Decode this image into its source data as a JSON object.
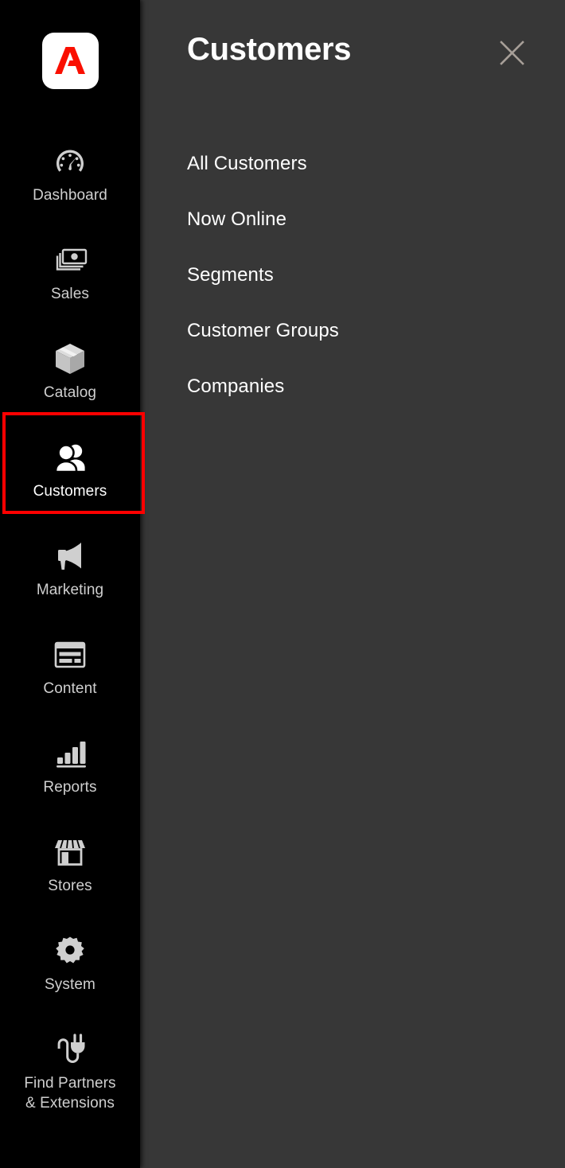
{
  "brand": {
    "logo_icon": "adobe-logo-icon",
    "logo_color": "#ff0000",
    "logo_tile_color": "#ffffff"
  },
  "colors": {
    "sidebar_background": "#000000",
    "panel_background": "#373737",
    "highlight_border": "#ff0000",
    "nav_label": "#cfcfcf",
    "active_label": "#ffffff",
    "close_icon": "#a79f98"
  },
  "sidebar": {
    "items": [
      {
        "label": "Dashboard",
        "icon": "gauge-icon",
        "active": false
      },
      {
        "label": "Sales",
        "icon": "money-stack-icon",
        "active": false
      },
      {
        "label": "Catalog",
        "icon": "box-icon",
        "active": false
      },
      {
        "label": "Customers",
        "icon": "users-icon",
        "active": true
      },
      {
        "label": "Marketing",
        "icon": "megaphone-icon",
        "active": false
      },
      {
        "label": "Content",
        "icon": "layout-page-icon",
        "active": false
      },
      {
        "label": "Reports",
        "icon": "bar-chart-icon",
        "active": false
      },
      {
        "label": "Stores",
        "icon": "storefront-icon",
        "active": false
      },
      {
        "label": "System",
        "icon": "gear-icon",
        "active": false
      },
      {
        "label": "Find Partners\n& Extensions",
        "icon": "plug-icon",
        "active": false
      }
    ]
  },
  "panel": {
    "title": "Customers",
    "close_icon": "close-x-icon",
    "items": [
      {
        "label": "All Customers"
      },
      {
        "label": "Now Online"
      },
      {
        "label": "Segments"
      },
      {
        "label": "Customer Groups"
      },
      {
        "label": "Companies"
      }
    ]
  }
}
